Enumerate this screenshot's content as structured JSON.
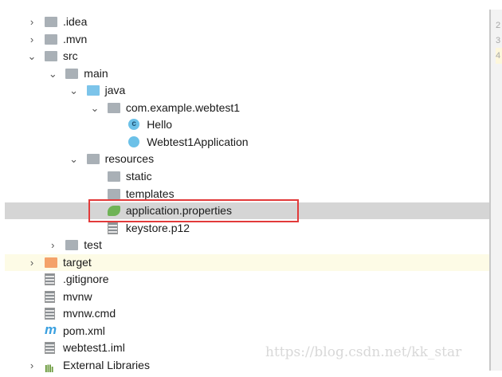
{
  "tree": [
    {
      "label": ".idea",
      "arrow": "›",
      "icon": "folder-icon"
    },
    {
      "label": ".mvn",
      "arrow": "›",
      "icon": "folder-icon"
    },
    {
      "label": "src",
      "arrow": "⌄",
      "icon": "folder-icon"
    },
    {
      "label": "main",
      "arrow": "⌄",
      "icon": "folder-icon"
    },
    {
      "label": "java",
      "arrow": "⌄",
      "icon": "source-folder-icon"
    },
    {
      "label": "com.example.webtest1",
      "arrow": "⌄",
      "icon": "package-icon"
    },
    {
      "label": "Hello",
      "icon": "class-icon"
    },
    {
      "label": "Webtest1Application",
      "icon": "spring-boot-class-icon"
    },
    {
      "label": "resources",
      "arrow": "⌄",
      "icon": "resources-folder-icon"
    },
    {
      "label": "static",
      "icon": "folder-icon"
    },
    {
      "label": "templates",
      "icon": "folder-icon"
    },
    {
      "label": "application.properties",
      "icon": "spring-properties-icon",
      "selected": true
    },
    {
      "label": "keystore.p12",
      "icon": "unknown-file-icon"
    },
    {
      "label": "test",
      "arrow": "›",
      "icon": "folder-icon"
    },
    {
      "label": "target",
      "arrow": "›",
      "icon": "excluded-folder-icon"
    },
    {
      "label": ".gitignore",
      "icon": "text-file-icon"
    },
    {
      "label": "mvnw",
      "icon": "text-file-icon"
    },
    {
      "label": "mvnw.cmd",
      "icon": "text-file-icon"
    },
    {
      "label": "pom.xml",
      "icon": "maven-icon",
      "glyph": "m"
    },
    {
      "label": "webtest1.iml",
      "icon": "module-file-icon"
    },
    {
      "label": "External Libraries",
      "arrow": "›",
      "icon": "libraries-icon",
      "glyph": "Illı"
    }
  ],
  "gutter": [
    "2",
    "3",
    "4"
  ],
  "watermark": "https://blog.csdn.net/kk_star"
}
